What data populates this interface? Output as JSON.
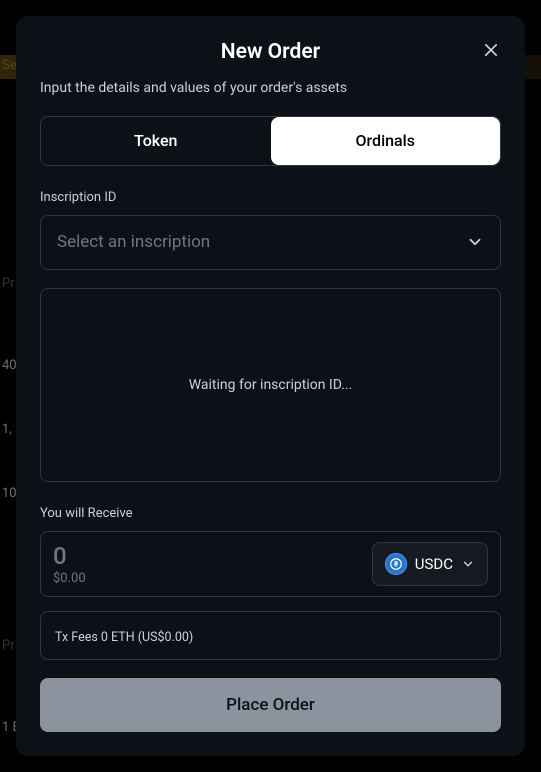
{
  "modal": {
    "title": "New Order",
    "subtitle": "Input the details and values of your order's assets",
    "tabs": {
      "token": "Token",
      "ordinals": "Ordinals"
    },
    "inscription": {
      "label": "Inscription ID",
      "placeholder": "Select an inscription",
      "waiting": "Waiting for inscription ID..."
    },
    "receive": {
      "label": "You will Receive",
      "amount": "0",
      "fiat": "$0.00",
      "currency": "USDC"
    },
    "fees": "Tx Fees 0 ETH (US$0.00)",
    "cta": "Place Order"
  },
  "backdrop": {
    "search_hint": "Se",
    "left_labels": [
      "Pr",
      "40",
      "1,",
      "10",
      "Pr",
      "1 E"
    ]
  }
}
